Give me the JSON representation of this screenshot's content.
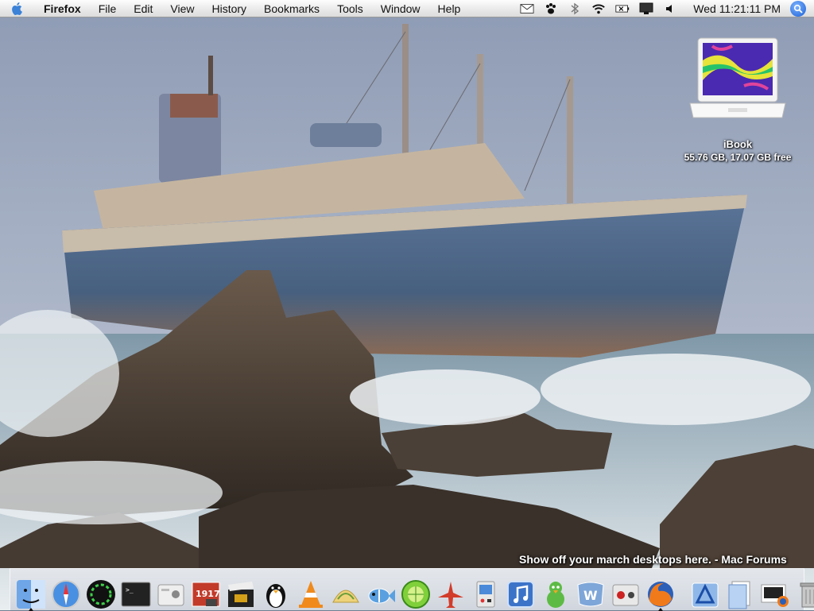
{
  "menubar": {
    "app_name": "Firefox",
    "menus": [
      "File",
      "Edit",
      "View",
      "History",
      "Bookmarks",
      "Tools",
      "Window",
      "Help"
    ],
    "status_icons": [
      "mail-icon",
      "paw-icon",
      "bluetooth-icon",
      "wifi-icon",
      "battery-icon",
      "display-icon",
      "volume-icon"
    ],
    "clock": "Wed 11:21:11 PM"
  },
  "desktop": {
    "drive_icon": {
      "name": "iBook",
      "info": "55.76 GB, 17.07 GB free"
    },
    "caption": "Show off your march desktops here. - Mac Forums"
  },
  "dock": {
    "apps": [
      {
        "icon": "finder-icon",
        "running": true
      },
      {
        "icon": "safari-icon",
        "running": false
      },
      {
        "icon": "activity-swirl-icon",
        "running": false
      },
      {
        "icon": "terminal-icon",
        "running": false
      },
      {
        "icon": "system-profiler-icon",
        "running": false
      },
      {
        "icon": "1917-photo-icon",
        "running": false
      },
      {
        "icon": "clapperboard-icon",
        "running": false
      },
      {
        "icon": "penguin-icon",
        "running": false
      },
      {
        "icon": "vlc-cone-icon",
        "running": false
      },
      {
        "icon": "taco-icon",
        "running": false
      },
      {
        "icon": "fish-icon",
        "running": false
      },
      {
        "icon": "limewire-icon",
        "running": false
      },
      {
        "icon": "airplane-icon",
        "running": false
      },
      {
        "icon": "arcade-icon",
        "running": false
      },
      {
        "icon": "itunes-icon",
        "running": false
      },
      {
        "icon": "adium-duck-icon",
        "running": false
      },
      {
        "icon": "word-icon",
        "running": false
      },
      {
        "icon": "soundboard-icon",
        "running": false
      },
      {
        "icon": "firefox-icon",
        "running": true
      }
    ],
    "docs": [
      {
        "icon": "applications-folder-icon"
      },
      {
        "icon": "documents-stack-icon"
      },
      {
        "icon": "screen-firefox-icon"
      },
      {
        "icon": "trash-icon"
      }
    ]
  }
}
